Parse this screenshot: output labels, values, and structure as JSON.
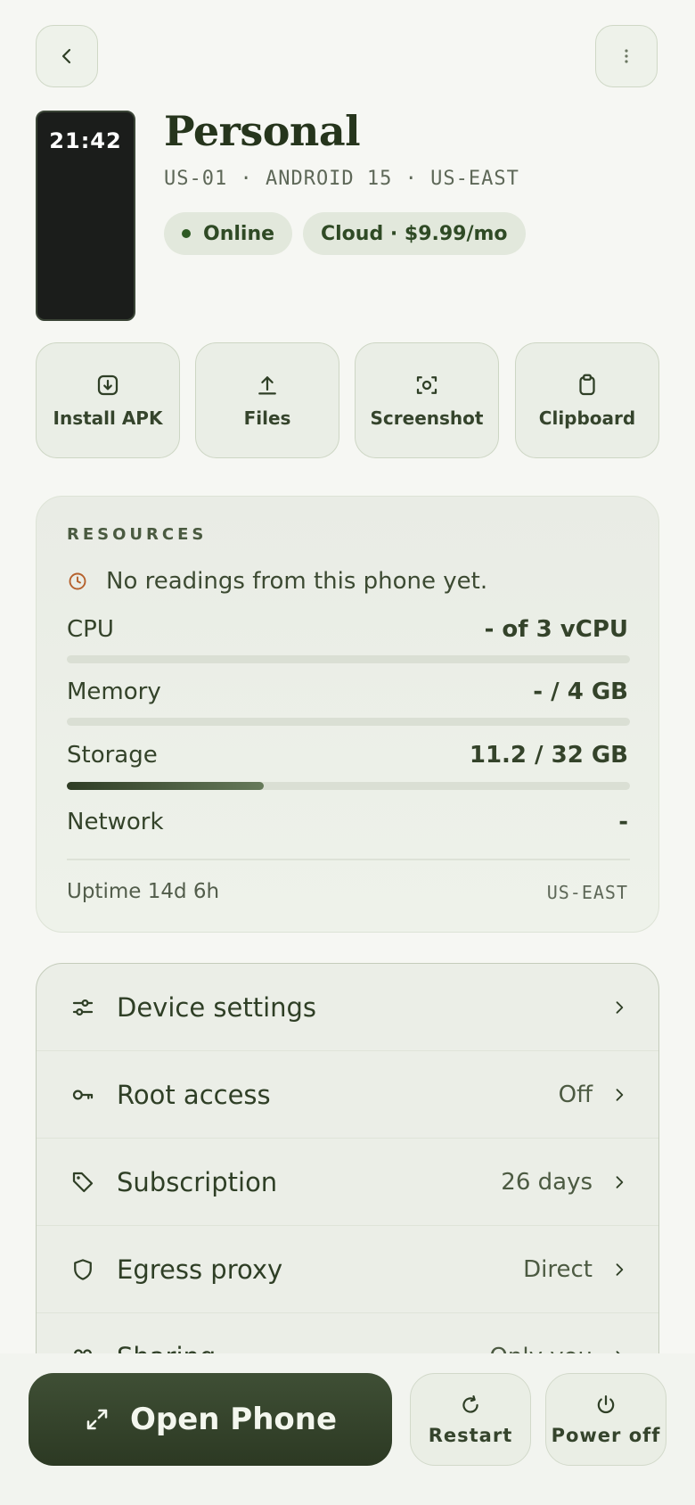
{
  "header": {
    "back_icon": "chevron-left-icon",
    "more_icon": "more-vertical-icon"
  },
  "device": {
    "thumbnail_time": "21:42",
    "name": "Personal",
    "subtitle": "US-01 · ANDROID 15 · US-EAST",
    "status": "Online",
    "plan": "Cloud · $9.99/mo"
  },
  "actions": [
    {
      "label": "Install APK",
      "icon": "download-box-icon"
    },
    {
      "label": "Files",
      "icon": "upload-icon"
    },
    {
      "label": "Screenshot",
      "icon": "screenshot-icon"
    },
    {
      "label": "Clipboard",
      "icon": "clipboard-icon"
    }
  ],
  "resources": {
    "title": "RESOURCES",
    "notice": "No readings from this phone yet.",
    "cpu": {
      "label": "CPU",
      "value": "- of 3 vCPU",
      "fraction": 0
    },
    "memory": {
      "label": "Memory",
      "value": "- / 4 GB",
      "fraction": 0
    },
    "storage": {
      "label": "Storage",
      "value": "11.2 / 32 GB",
      "fraction": 0.35
    },
    "network": {
      "label": "Network",
      "value": "-"
    },
    "uptime": "Uptime 14d 6h",
    "region": "US-EAST"
  },
  "menu": {
    "items": [
      {
        "label": "Device settings",
        "value": "",
        "icon": "sliders-icon"
      },
      {
        "label": "Root access",
        "value": "Off",
        "icon": "key-icon"
      },
      {
        "label": "Subscription",
        "value": "26 days",
        "icon": "tag-icon"
      },
      {
        "label": "Egress proxy",
        "value": "Direct",
        "icon": "shield-icon"
      },
      {
        "label": "Sharing",
        "value": "Only you",
        "icon": "people-icon"
      }
    ]
  },
  "bottom_bar": {
    "open_label": "Open Phone",
    "restart_label": "Restart",
    "power_label": "Power off"
  },
  "colors": {
    "accent_dark": "#2f3d25",
    "background": "#f6f7f3",
    "warning": "#b5602b"
  }
}
